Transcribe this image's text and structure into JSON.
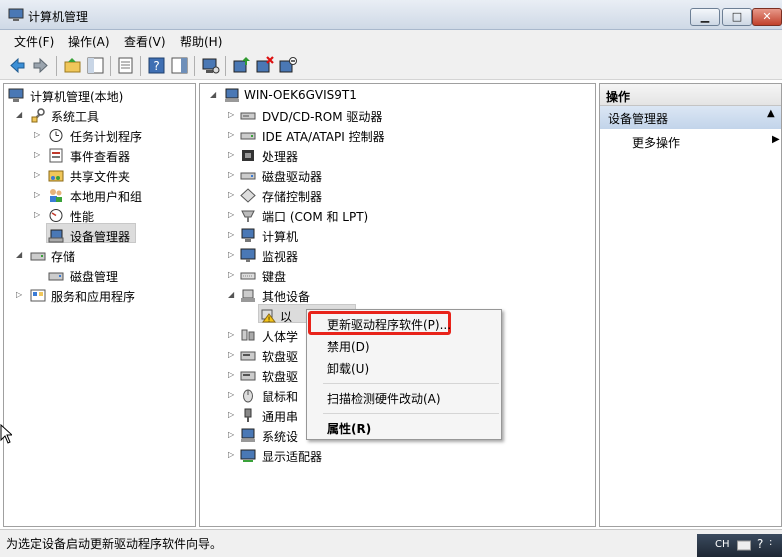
{
  "window": {
    "title": "计算机管理"
  },
  "menubar": [
    "文件(F)",
    "操作(A)",
    "查看(V)",
    "帮助(H)"
  ],
  "toolbar_icons": [
    "back-icon",
    "forward-icon",
    "up-folder-icon",
    "show-hide-tree-icon",
    "properties-icon",
    "help-icon",
    "action-pane-icon",
    "scan-hardware-icon",
    "update-driver-icon",
    "uninstall-driver-icon",
    "disable-device-icon"
  ],
  "left_tree": {
    "root": "计算机管理(本地)",
    "system_tools": "系统工具",
    "task_scheduler": "任务计划程序",
    "event_viewer": "事件查看器",
    "shared_folders": "共享文件夹",
    "local_users": "本地用户和组",
    "performance": "性能",
    "device_manager": "设备管理器",
    "storage": "存储",
    "disk_management": "磁盘管理",
    "services_apps": "服务和应用程序"
  },
  "device_tree": {
    "computer_name": "WIN-OEK6GVIS9T1",
    "dvd": "DVD/CD-ROM 驱动器",
    "ide": "IDE ATA/ATAPI 控制器",
    "cpu": "处理器",
    "disk": "磁盘驱动器",
    "storage_ctrl": "存储控制器",
    "ports": "端口 (COM 和 LPT)",
    "computer": "计算机",
    "monitor": "监视器",
    "keyboard": "键盘",
    "other_devices": "其他设备",
    "unknown_device": "以",
    "hid": "人体学",
    "soft1": "软盘驱",
    "soft2": "软盘驱",
    "mouse": "鼠标和",
    "usb": "通用串",
    "system_devices": "系统设",
    "display": "显示适配器"
  },
  "actions": {
    "header": "操作",
    "section": "设备管理器",
    "more": "更多操作"
  },
  "context_menu": {
    "update": "更新驱动程序软件(P)...",
    "disable": "禁用(D)",
    "uninstall": "卸载(U)",
    "scan": "扫描检测硬件改动(A)",
    "properties": "属性(R)"
  },
  "status": {
    "text": "为选定设备启动更新驱动程序软件向导。"
  },
  "tray": {
    "lang": "CH"
  }
}
